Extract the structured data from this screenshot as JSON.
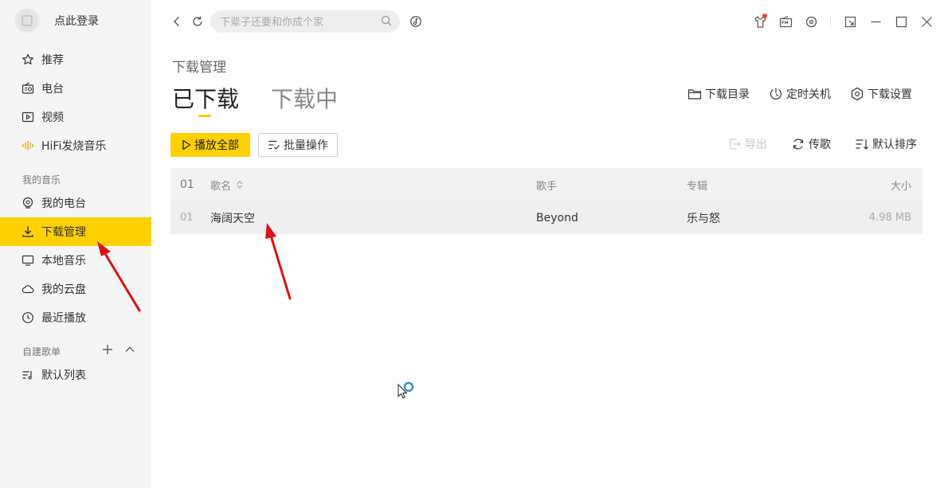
{
  "sidebar": {
    "login_label": "点此登录",
    "items": [
      {
        "label": "推荐",
        "icon": "star-icon"
      },
      {
        "label": "电台",
        "icon": "radio-icon"
      },
      {
        "label": "视频",
        "icon": "video-icon"
      },
      {
        "label": "HiFi发烧音乐",
        "icon": "hifi-waveform-icon"
      }
    ],
    "my_music_label": "我的音乐",
    "my_items": [
      {
        "label": "我的电台",
        "icon": "my-radio-icon"
      },
      {
        "label": "下载管理",
        "icon": "download-icon",
        "active": true
      },
      {
        "label": "本地音乐",
        "icon": "monitor-icon"
      },
      {
        "label": "我的云盘",
        "icon": "cloud-icon"
      },
      {
        "label": "最近播放",
        "icon": "clock-icon"
      }
    ],
    "playlist_label": "自建歌单",
    "playlists": [
      {
        "label": "默认列表",
        "icon": "playlist-icon"
      }
    ]
  },
  "search": {
    "placeholder": "下辈子还要和你成个家"
  },
  "main": {
    "page_title": "下载管理",
    "tabs": [
      {
        "label": "已下载",
        "active": true
      },
      {
        "label": "下载中",
        "active": false
      }
    ],
    "top_actions": {
      "download_dir": "下载目录",
      "timer_shutdown": "定时关机",
      "download_settings": "下载设置"
    },
    "play_all": "播放全部",
    "batch": "批量操作",
    "export": "导出",
    "transfer": "传歌",
    "sort": "默认排序",
    "table": {
      "header": {
        "index": "01",
        "name": "歌名",
        "artist": "歌手",
        "album": "专辑",
        "size": "大小"
      },
      "rows": [
        {
          "index": "01",
          "name": "海阔天空",
          "artist": "Beyond",
          "album": "乐与怒",
          "size": "4.98 MB"
        }
      ]
    }
  },
  "colors": {
    "accent": "#ffd100",
    "sidebar_bg": "#f5f5f5",
    "annotation_arrow": "#e01010"
  }
}
